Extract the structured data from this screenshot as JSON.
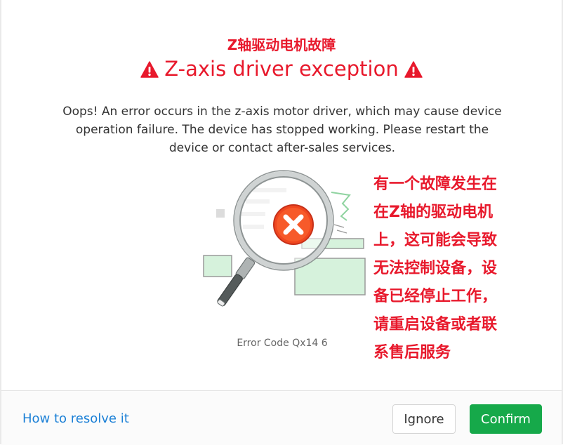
{
  "dialog": {
    "title_cn": "Z轴驱动电机故障",
    "title": "Z-axis driver exception",
    "description": "Oops! An error occurs in the z-axis motor driver, which may cause device operation failure. The device has stopped working. Please restart the device or contact after-sales services.",
    "error_code": "Error Code Qx14 6",
    "note_cn_lines": [
      "有一个故障发生在",
      "在Z轴的驱动电机",
      "上，这可能会导致",
      "无法控制设备，设",
      "备已经停止工作，",
      "请重启设备或者联",
      "系售后服务"
    ],
    "icons": {
      "title_left": "warning-triangle",
      "title_right": "warning-triangle",
      "illustration": "magnifier-error-x"
    }
  },
  "footer": {
    "help_link": "How to resolve it",
    "ignore_label": "Ignore",
    "confirm_label": "Confirm"
  },
  "colors": {
    "error_red": "#e8192c",
    "confirm_green": "#16a94a",
    "link_blue": "#1a7fd6"
  }
}
